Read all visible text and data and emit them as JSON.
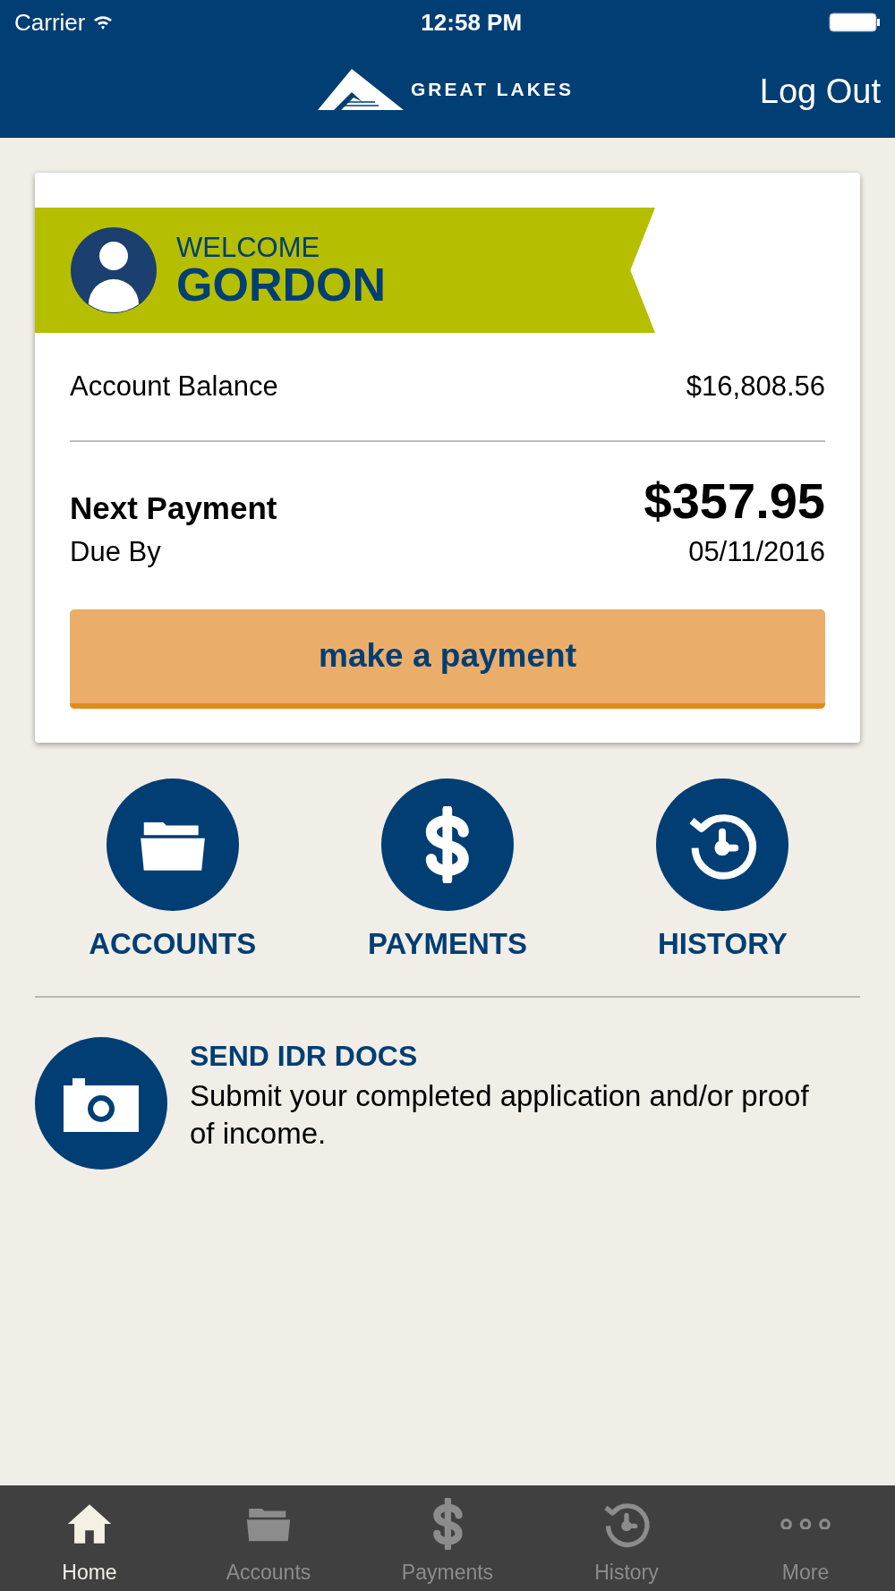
{
  "status_bar": {
    "carrier": "Carrier",
    "time": "12:58 PM"
  },
  "header": {
    "logo_text": "GREAT LAKES",
    "action": "Log Out"
  },
  "welcome": {
    "greeting": "WELCOME",
    "name": "GORDON"
  },
  "balance": {
    "label": "Account Balance",
    "value": "$16,808.56"
  },
  "next_payment": {
    "label": "Next Payment",
    "amount": "$357.95",
    "due_label": "Due By",
    "due_date": "05/11/2016"
  },
  "payment_button": "make a payment",
  "quick_actions": [
    {
      "kind": "folder",
      "label": "ACCOUNTS"
    },
    {
      "kind": "dollar",
      "label": "PAYMENTS"
    },
    {
      "kind": "history",
      "label": "HISTORY"
    }
  ],
  "idr": {
    "title": "SEND IDR DOCS",
    "text": "Submit your completed application and/or proof of income."
  },
  "tab_bar": [
    {
      "kind": "home",
      "label": "Home",
      "selected": true
    },
    {
      "kind": "folder",
      "label": "Accounts",
      "selected": false
    },
    {
      "kind": "dollar",
      "label": "Payments",
      "selected": false
    },
    {
      "kind": "history",
      "label": "History",
      "selected": false
    },
    {
      "kind": "more",
      "label": "More",
      "selected": false
    }
  ]
}
